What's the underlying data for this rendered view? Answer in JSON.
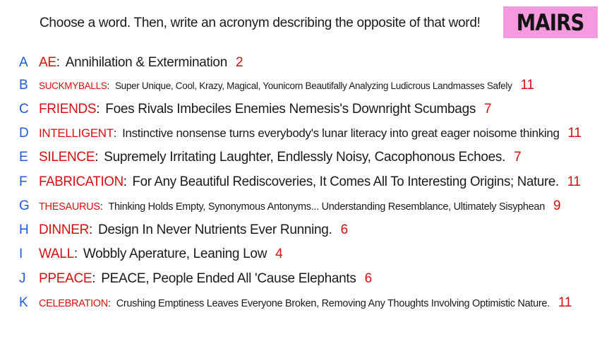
{
  "prompt": "Choose a word. Then, write an acronym describing the opposite of that word!",
  "badge": "MAIRS",
  "colors": {
    "badge_bg": "#f59ade",
    "letter": "#1f5bd8",
    "word": "#d40f0f",
    "count": "#d40f0f",
    "text": "#1a1a1a"
  },
  "entries": [
    {
      "letter": "A",
      "word": "AE",
      "acronym": "Annihilation & Extermination",
      "count": "2"
    },
    {
      "letter": "B",
      "word": "SUCKMYBALLS",
      "acronym": "Super Unique, Cool, Krazy, Magical, Younicorn Beautifally Analyzing Ludicrous Landmasses Safely",
      "count": "11"
    },
    {
      "letter": "C",
      "word": "FRIENDS",
      "acronym": "Foes Rivals Imbeciles Enemies Nemesis's Downright Scumbags",
      "count": "7"
    },
    {
      "letter": "D",
      "word": "INTELLIGENT",
      "acronym": "Instinctive nonsense turns everybody's lunar literacy into great eager noisome thinking",
      "count": "11"
    },
    {
      "letter": "E",
      "word": "SILENCE",
      "acronym": "Supremely Irritating Laughter, Endlessly Noisy, Cacophonous Echoes.",
      "count": "7"
    },
    {
      "letter": "F",
      "word": "FABRICATION",
      "acronym": "For Any Beautiful Rediscoveries, It Comes All To Interesting Origins; Nature.",
      "count": "11"
    },
    {
      "letter": "G",
      "word": "THESAURUS",
      "acronym": "Thinking Holds Empty, Synonymous Antonyms... Understanding Resemblance, Ultimately Sisyphean",
      "count": "9"
    },
    {
      "letter": "H",
      "word": "DINNER",
      "acronym": "Design In Never Nutrients Ever Running.",
      "count": "6"
    },
    {
      "letter": "I",
      "word": "WALL",
      "acronym": "Wobbly Aperature, Leaning Low",
      "count": "4"
    },
    {
      "letter": "J",
      "word": "PPEACE",
      "acronym": "PEACE, People Ended All 'Cause Elephants",
      "count": "6"
    },
    {
      "letter": "K",
      "word": "CELEBRATION",
      "acronym": "Crushing Emptiness Leaves Everyone Broken, Removing Any Thoughts Involving Optimistic Nature.",
      "count": "11"
    }
  ]
}
